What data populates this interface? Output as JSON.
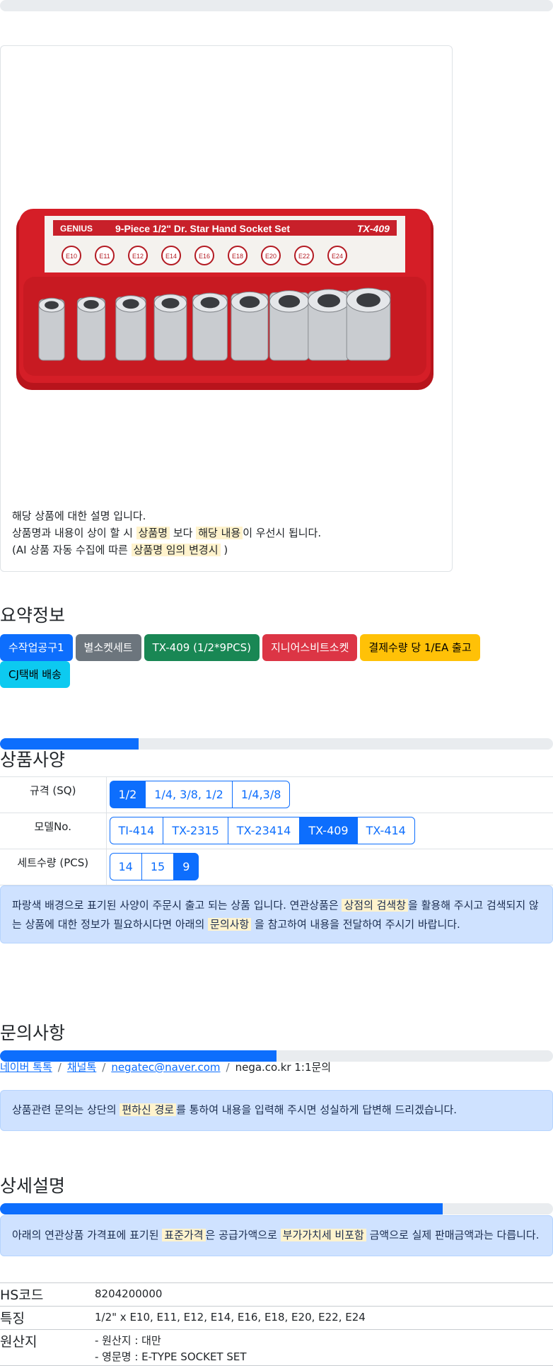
{
  "image_card": {
    "product_image": {
      "brand": "GENIUS",
      "label_title": "9-Piece 1/2\" Dr. Star Hand Socket Set",
      "label_code": "TX-409",
      "socket_sizes": [
        "E10",
        "E11",
        "E12",
        "E14",
        "E16",
        "E18",
        "E20",
        "E22",
        "E24"
      ],
      "case_color": "#d51e27"
    },
    "description": {
      "line1": "해당 상품에 대한 설명 입니다.",
      "line2_a": "상품명과 내용이 상이 할 시",
      "line2_hl1": "상품명",
      "line2_b": "보다",
      "line2_hl2": "해당 내용",
      "line2_c": "이 우선시 됩니다.",
      "line3_a": "(AI 상품 자동 수집에 따른",
      "line3_hl": "상품명 임의 변경시",
      "line3_b": ")"
    }
  },
  "summary": {
    "title": "요약정보",
    "badges": [
      {
        "label": "수작업공구1",
        "color": "#0d6efd"
      },
      {
        "label": "별소켓세트",
        "color": "#6c757d"
      },
      {
        "label": "TX-409 (1/2*9PCS)",
        "color": "#198754"
      },
      {
        "label": "지니어스비트소켓",
        "color": "#dc3545"
      },
      {
        "label": "결제수량 당 1/EA 출고",
        "color": "#ffc107"
      },
      {
        "label": "CJ택배 배송",
        "color": "#0dcaf0"
      }
    ]
  },
  "progress": {
    "spec": 0.25,
    "inquiry": 0.5,
    "detail": 0.8
  },
  "spec": {
    "title": "상품사양",
    "rows": [
      {
        "label": "규격 (SQ)",
        "options": [
          "1/2",
          "1/4, 3/8, 1/2",
          "1/4,3/8"
        ],
        "selected": "1/2"
      },
      {
        "label": "모델No.",
        "options": [
          "TI-414",
          "TX-2315",
          "TX-23414",
          "TX-409",
          "TX-414"
        ],
        "selected": "TX-409"
      },
      {
        "label": "세트수량 (PCS)",
        "options": [
          "14",
          "15",
          "9"
        ],
        "selected": "9"
      }
    ],
    "notice": {
      "l1_a": "파랑색 배경으로 표기된 사양이 주문시 출고 되는 상품 입니다. 연관상품은",
      "l1_hl": "상점의 검색창",
      "l1_b": "을 활용해 주시고 검색되지 않",
      "l2_a": "는 상품에 대한 정보가 필요하시다면 아래의",
      "l2_hl": "문의사항",
      "l2_b": "을 참고하여 내용을 전달하여 주시기 바랍니다."
    }
  },
  "inquiry": {
    "title": "문의사항",
    "links": [
      "네이버 톡톡",
      "채널톡",
      "negatec@naver.com"
    ],
    "last_crumb": "nega.co.kr 1:1문의",
    "notice": {
      "a": "상품관련 문의는 상단의",
      "hl": "편하신 경로",
      "b": "를 통하여 내용을 입력해 주시면 성실하게 답변해 드리겠습니다."
    }
  },
  "detail": {
    "title": "상세설명",
    "notice": {
      "a": "아래의 연관상품 가격표에 표기된",
      "hl1": "표준가격",
      "b": "은 공급가액으로",
      "hl2": "부가가치세 비포함",
      "c": "금액으로 실제 판매금액과는 다릅니다."
    },
    "rows": [
      {
        "key": "HS코드",
        "values": [
          "8204200000"
        ]
      },
      {
        "key": "특징",
        "values": [
          "1/2\" x E10, E11, E12, E14, E16, E18, E20, E22, E24"
        ]
      },
      {
        "key": "원산지",
        "values": [
          "- 원산지 : 대만",
          "- 영문명 : E-TYPE SOCKET SET"
        ]
      }
    ]
  }
}
